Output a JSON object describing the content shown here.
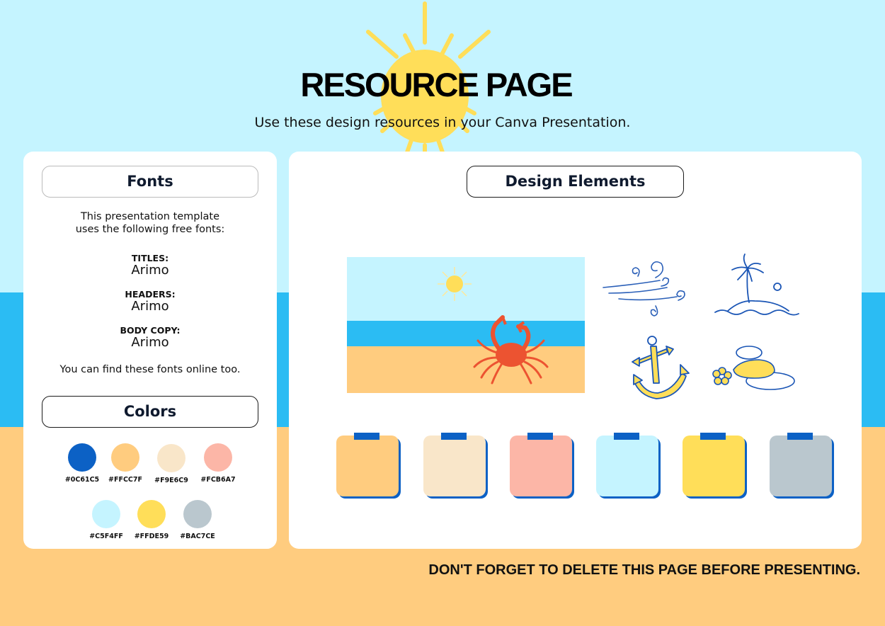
{
  "header": {
    "title": "RESOURCE PAGE",
    "subtitle": "Use these design resources in your Canva Presentation."
  },
  "fonts_panel": {
    "heading": "Fonts",
    "intro_line1": "This presentation template",
    "intro_line2": "uses the following free fonts:",
    "groups": [
      {
        "label": "TITLES:",
        "font": "Arimo"
      },
      {
        "label": "HEADERS:",
        "font": "Arimo"
      },
      {
        "label": "BODY COPY:",
        "font": "Arimo"
      }
    ],
    "outro": "You can find these fonts online too."
  },
  "colors_panel": {
    "heading": "Colors",
    "swatches": [
      {
        "hex": "#0C61C5"
      },
      {
        "hex": "#FFCC7F"
      },
      {
        "hex": "#F9E6C9"
      },
      {
        "hex": "#FCB6A7"
      },
      {
        "hex": "#C5F4FF"
      },
      {
        "hex": "#FFDE59"
      },
      {
        "hex": "#BAC7CE"
      }
    ]
  },
  "design_panel": {
    "heading": "Design Elements",
    "elements": [
      {
        "name": "beach-crab-scene"
      },
      {
        "name": "wind-swirls"
      },
      {
        "name": "palm-island"
      },
      {
        "name": "anchor"
      },
      {
        "name": "stones-flower"
      }
    ],
    "notes": [
      {
        "color": "#FFCC7F"
      },
      {
        "color": "#F9E6C9"
      },
      {
        "color": "#FCB6A7"
      },
      {
        "color": "#C5F4FF"
      },
      {
        "color": "#FFDE59"
      },
      {
        "color": "#BAC7CE"
      }
    ]
  },
  "footer": {
    "reminder": "DON'T FORGET TO DELETE THIS PAGE BEFORE PRESENTING."
  },
  "theme": {
    "sky": "#C5F4FF",
    "sea": "#2BBCF3",
    "sand": "#FFCC7F",
    "sun": "#FFDE59",
    "accent": "#0C61C5"
  }
}
